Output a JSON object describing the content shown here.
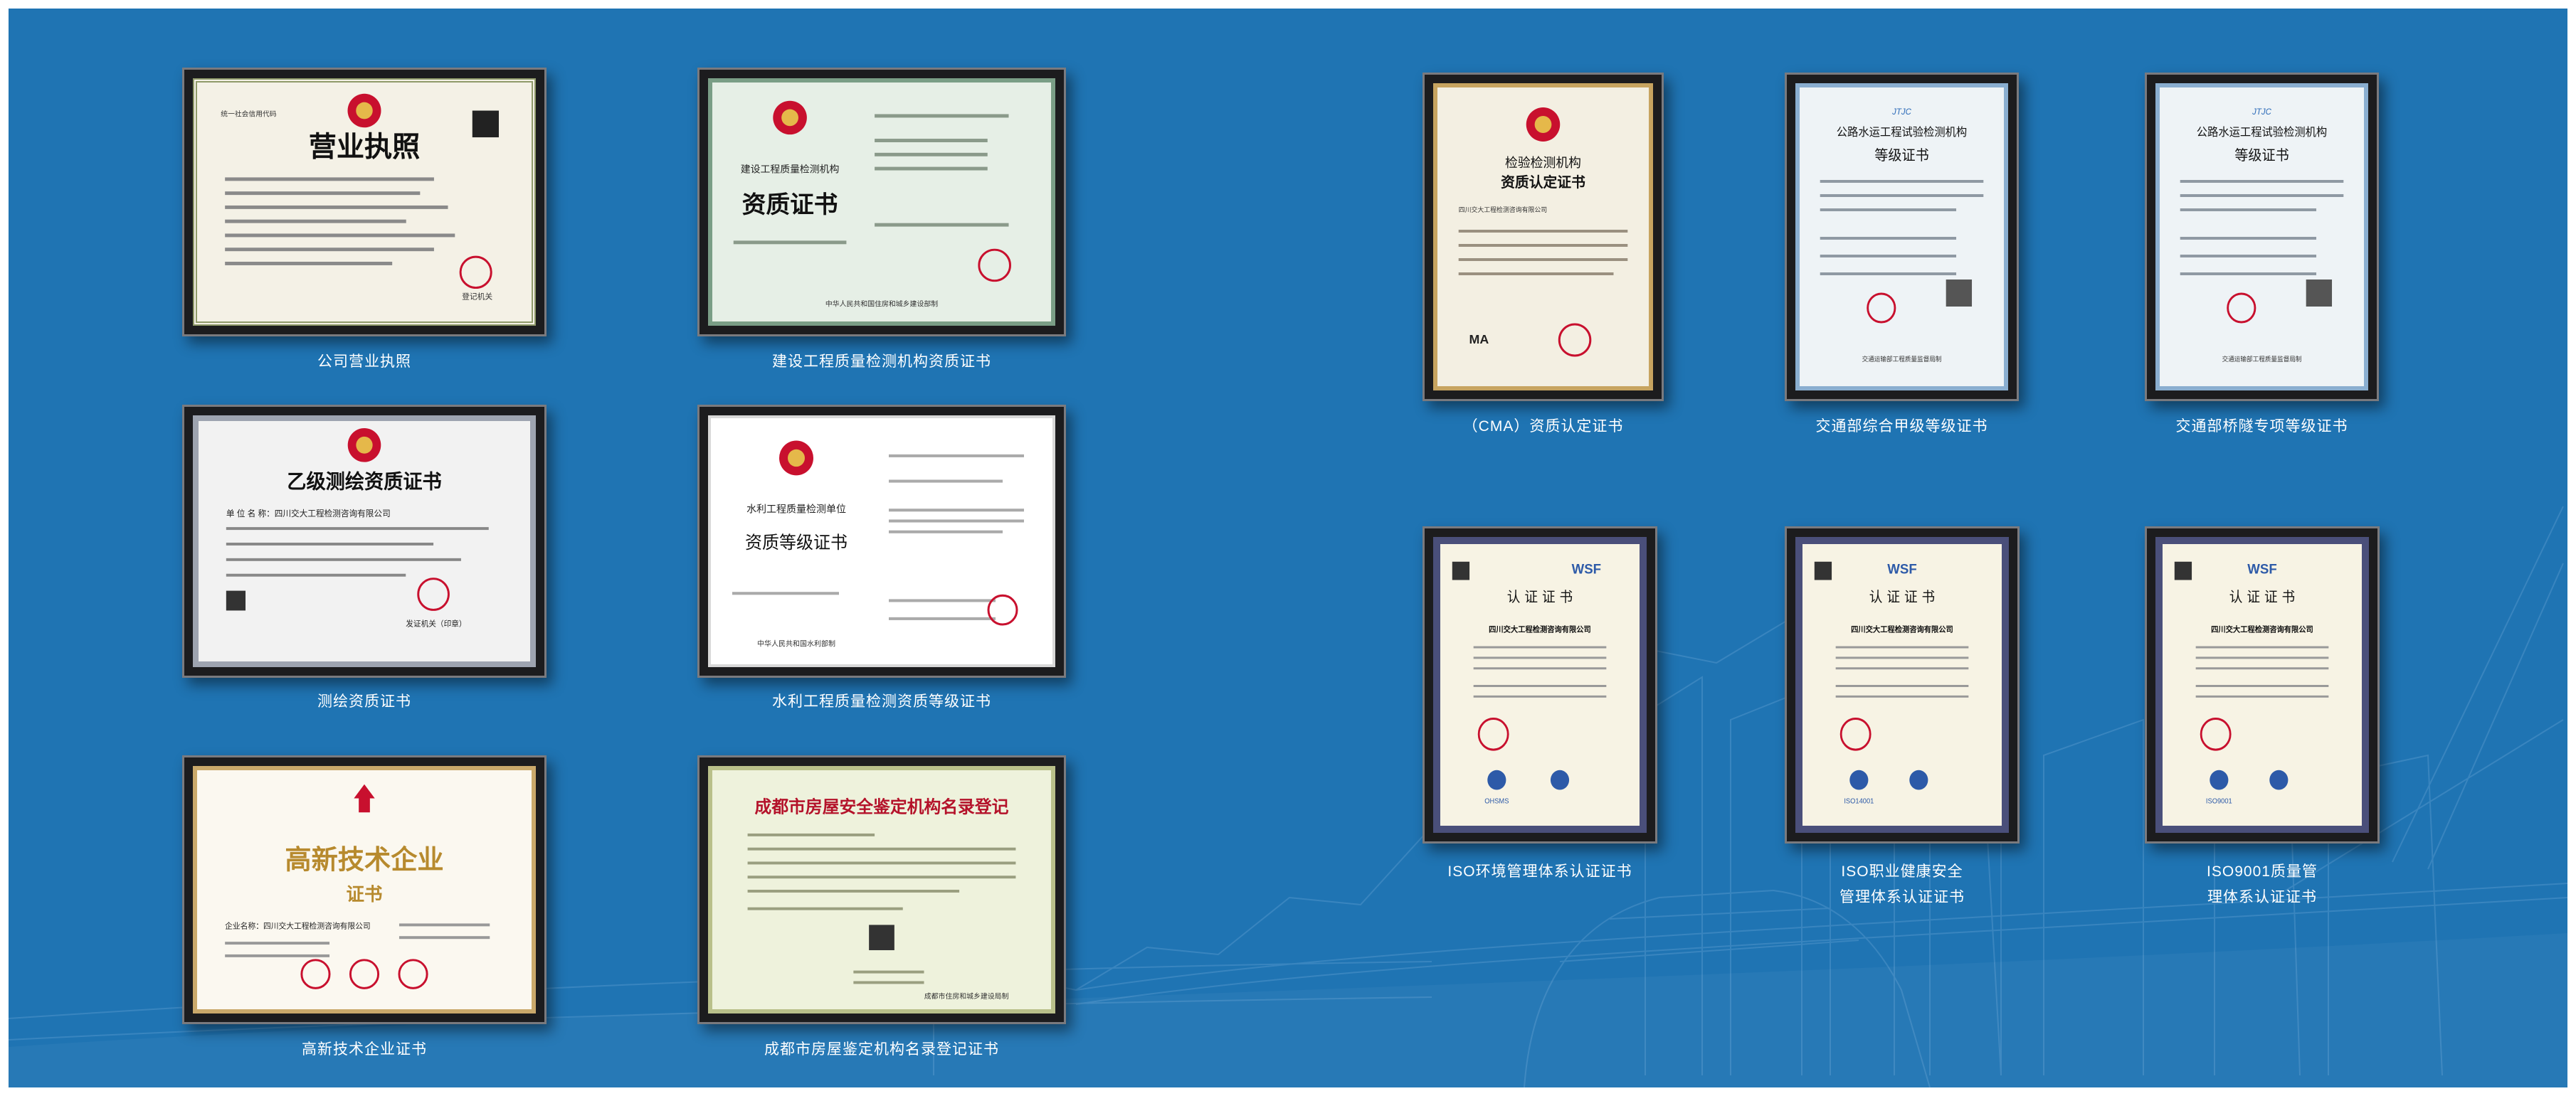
{
  "certificates": [
    {
      "caption": [
        "公司营业执照"
      ],
      "doc_title": "营业执照",
      "doc_lines": [
        "统一社会信用代码",
        "登记机关"
      ]
    },
    {
      "caption": [
        "建设工程质量检测机构资质证书"
      ],
      "doc_title": "资质证书",
      "doc_lines": [
        "建设工程质量检测机构",
        "中华人民共和国住房和城乡建设部制"
      ]
    },
    {
      "caption": [
        "测绘资质证书"
      ],
      "doc_title": "乙级测绘资质证书",
      "doc_lines": [
        "单 位 名 称：四川交大工程检测咨询有限公司",
        "发证机关（印章）"
      ]
    },
    {
      "caption": [
        "水利工程质量检测资质等级证书"
      ],
      "doc_title": "资质等级证书",
      "doc_lines": [
        "水利工程质量检测单位",
        "中华人民共和国水利部制"
      ]
    },
    {
      "caption": [
        "高新技术企业证书"
      ],
      "doc_title": "高新技术企业",
      "doc_lines": [
        "证书",
        "企业名称：四川交大工程检测咨询有限公司"
      ]
    },
    {
      "caption": [
        "成都市房屋鉴定机构名录登记证书"
      ],
      "doc_title": "成都市房屋安全鉴定机构名录登记",
      "doc_lines": [
        "成都市住房和城乡建设局制"
      ]
    },
    {
      "caption": [
        "（CMA）资质认定证书"
      ],
      "doc_title": "资质认定证书",
      "doc_lines": [
        "检验检测机构",
        "四川交大工程检测咨询有限公司"
      ]
    },
    {
      "caption": [
        "交通部综合甲级等级证书"
      ],
      "doc_title": "等级证书",
      "doc_lines": [
        "JTJC",
        "公路水运工程试验检测机构",
        "交通运输部工程质量监督局制"
      ]
    },
    {
      "caption": [
        "交通部桥隧专项等级证书"
      ],
      "doc_title": "等级证书",
      "doc_lines": [
        "JTJC",
        "公路水运工程试验检测机构",
        "交通运输部工程质量监督局制"
      ]
    },
    {
      "caption": [
        "ISO环境管理体系认证证书"
      ],
      "doc_title": "认 证 证 书",
      "doc_lines": [
        "WSF",
        "四川交大工程检测咨询有限公司",
        "OHSMS"
      ]
    },
    {
      "caption": [
        "ISO职业健康安全",
        "管理体系认证证书"
      ],
      "doc_title": "认 证 证 书",
      "doc_lines": [
        "WSF",
        "四川交大工程检测咨询有限公司",
        "ISO14001"
      ]
    },
    {
      "caption": [
        "ISO9001质量管",
        "理体系认证证书"
      ],
      "doc_title": "认 证 证 书",
      "doc_lines": [
        "WSF",
        "四川交大工程检测咨询有限公司",
        "ISO9001"
      ]
    }
  ],
  "colors": {
    "background": "#1f74b3",
    "frame": "#1c1c1e",
    "caption_text": "#ffffff",
    "seal_red": "#c8102e",
    "title_red": "#b4122a"
  }
}
